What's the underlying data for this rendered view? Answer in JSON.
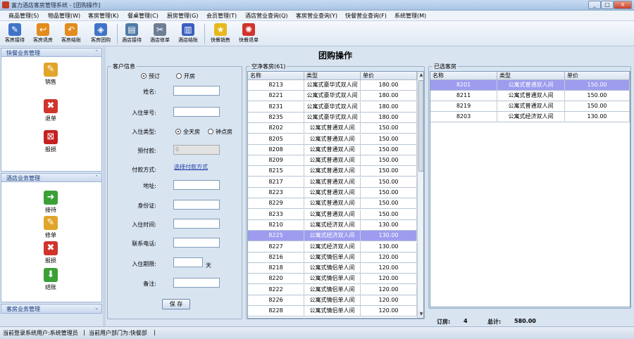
{
  "window": {
    "title": "富力酒店客房管理系统 - [团购操作]",
    "controls": [
      "_",
      "□",
      "×"
    ]
  },
  "menu": [
    "商品管理(S)",
    "物品管理(W)",
    "客房管理(K)",
    "餐桌管理(C)",
    "厨房管理(G)",
    "会员管理(T)",
    "酒店营业查询(Q)",
    "客房营业查询(Y)",
    "快餐营业查询(F)",
    "系统管理(M)"
  ],
  "toolbar": {
    "items": [
      {
        "label": "客房接待",
        "icon": "pen-icon",
        "color": "#3f74c8"
      },
      {
        "label": "客房退房",
        "icon": "return-icon",
        "color": "#e38b1c"
      },
      {
        "label": "客房结账",
        "icon": "undo-icon",
        "color": "#e38b1c"
      },
      {
        "label": "客房团购",
        "icon": "group-icon",
        "color": "#3f74c8"
      },
      {
        "label": "酒店接待",
        "icon": "card-icon",
        "color": "#4f7aa8"
      },
      {
        "label": "酒店修单",
        "icon": "tools-icon",
        "color": "#6d7f94"
      },
      {
        "label": "酒店结账",
        "icon": "books-icon",
        "color": "#3a5fbf"
      },
      {
        "label": "快餐销售",
        "icon": "star-icon",
        "color": "#e8b81c"
      },
      {
        "label": "快餐退单",
        "icon": "gear-icon",
        "color": "#d0342c"
      }
    ]
  },
  "sidebar": {
    "sections": [
      {
        "title": "快餐业务管理",
        "items": [
          {
            "label": "销售",
            "icon": "pencil-icon",
            "color": "#e0a52a"
          },
          {
            "label": "退单",
            "icon": "cancel-icon",
            "color": "#d0342c"
          },
          {
            "label": "报损",
            "icon": "damage-icon",
            "color": "#c42222"
          }
        ]
      },
      {
        "title": "酒店业务管理",
        "items": [
          {
            "label": "接待",
            "icon": "arrow-right-icon",
            "color": "#3aa036"
          },
          {
            "label": "修单",
            "icon": "pencil-icon",
            "color": "#e0a52a"
          },
          {
            "label": "报损",
            "icon": "cancel-icon",
            "color": "#d0342c"
          },
          {
            "label": "结账",
            "icon": "arrow-down-icon",
            "color": "#3aa036"
          }
        ]
      },
      {
        "title": "客房业务管理",
        "items": []
      }
    ]
  },
  "main": {
    "heading": "团购操作"
  },
  "customer": {
    "legend": "客户信息",
    "mode_options": [
      "预订",
      "开房"
    ],
    "mode_selected": "预订",
    "fields": [
      {
        "label": "姓名:",
        "value": ""
      },
      {
        "label": "入住单号:",
        "value": ""
      }
    ],
    "stay_type_label": "入住类型:",
    "stay_type_options": [
      "全天房",
      "钟点房"
    ],
    "stay_type_selected": "全天房",
    "deposit_label": "预付款:",
    "deposit_value": "0",
    "payment_label": "付款方式:",
    "payment_link": "选择付款方式",
    "fields2": [
      {
        "label": "地址:",
        "value": ""
      },
      {
        "label": "身份证:",
        "value": ""
      },
      {
        "label": "入住时间:",
        "value": ""
      },
      {
        "label": "联系电话:",
        "value": ""
      }
    ],
    "period_label": "入住期限:",
    "period_value": "",
    "period_unit": "天",
    "remark_label": "备注:",
    "remark_value": "",
    "save_label": "保 存"
  },
  "empty_rooms": {
    "legend": "空净客房(61)",
    "columns": [
      "名称",
      "类型",
      "单价"
    ],
    "selected_index": 14,
    "rows": [
      [
        "8213",
        "公寓式豪华式双人间",
        "180.00"
      ],
      [
        "8221",
        "公寓式豪华式双人间",
        "180.00"
      ],
      [
        "8231",
        "公寓式豪华式双人间",
        "180.00"
      ],
      [
        "8235",
        "公寓式豪华式双人间",
        "180.00"
      ],
      [
        "8202",
        "公寓式普通双人间",
        "150.00"
      ],
      [
        "8205",
        "公寓式普通双人间",
        "150.00"
      ],
      [
        "8208",
        "公寓式普通双人间",
        "150.00"
      ],
      [
        "8209",
        "公寓式普通双人间",
        "150.00"
      ],
      [
        "8215",
        "公寓式普通双人间",
        "150.00"
      ],
      [
        "8217",
        "公寓式普通双人间",
        "150.00"
      ],
      [
        "8223",
        "公寓式普通双人间",
        "150.00"
      ],
      [
        "8229",
        "公寓式普通双人间",
        "150.00"
      ],
      [
        "8233",
        "公寓式普通双人间",
        "150.00"
      ],
      [
        "8210",
        "公寓式经济双人间",
        "130.00"
      ],
      [
        "8225",
        "公寓式经济双人间",
        "130.00"
      ],
      [
        "8227",
        "公寓式经济双人间",
        "130.00"
      ],
      [
        "8216",
        "公寓式情侣单人间",
        "120.00"
      ],
      [
        "8218",
        "公寓式情侣单人间",
        "120.00"
      ],
      [
        "8220",
        "公寓式情侣单人间",
        "120.00"
      ],
      [
        "8222",
        "公寓式情侣单人间",
        "120.00"
      ],
      [
        "8226",
        "公寓式情侣单人间",
        "120.00"
      ],
      [
        "8228",
        "公寓式情侣单人间",
        "120.00"
      ]
    ]
  },
  "selected_rooms": {
    "legend": "已选客房",
    "columns": [
      "名称",
      "类型",
      "单价"
    ],
    "selected_index": 0,
    "rows": [
      [
        "8201",
        "公寓式普通双人间",
        "150.00"
      ],
      [
        "8211",
        "公寓式普通双人间",
        "150.00"
      ],
      [
        "8219",
        "公寓式普通双人间",
        "150.00"
      ],
      [
        "8203",
        "公寓式经济双人间",
        "130.00"
      ]
    ]
  },
  "totals": {
    "count_label": "订房:",
    "count_value": "4",
    "sum_label": "总计:",
    "sum_value": "580.00"
  },
  "status": {
    "user": "当前登录系统用户:系统管理员",
    "dept": "当前用户部门为:快餐部"
  }
}
